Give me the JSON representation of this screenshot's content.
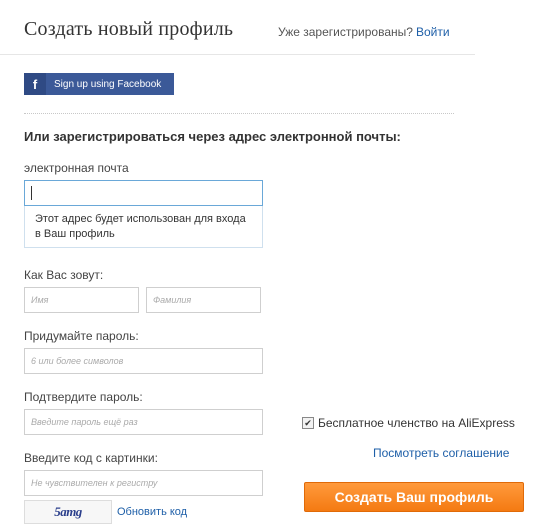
{
  "header": {
    "title": "Создать новый профиль",
    "already_text": "Уже зарегистрированы?",
    "login_link": "Войти"
  },
  "facebook": {
    "icon": "f",
    "label": "Sign up using Facebook",
    "color": "#3b5998"
  },
  "form": {
    "subheading": "Или зарегистрироваться через адрес электронной почты:",
    "email_label": "электронная почта",
    "email_value": "",
    "email_hint": "Этот адрес будет использован для входа в Ваш профиль",
    "name_label": "Как Вас зовут:",
    "first_name_placeholder": "Имя",
    "last_name_placeholder": "Фамилия",
    "password_label": "Придумайте пароль:",
    "password_placeholder": "6 или более символов",
    "confirm_label": "Подтвердите пароль:",
    "confirm_placeholder": "Введите пароль ещё раз",
    "captcha_label": "Введите код с картинки:",
    "captcha_placeholder": "Не чувствителен к регистру",
    "captcha_image_text": "5amg",
    "refresh_link": "Обновить код"
  },
  "side": {
    "membership_checkbox_label": "Бесплатное членство на AliExpress",
    "membership_checked": true,
    "agreement_link": "Посмотреть соглашение",
    "create_button": "Создать Ваш профиль",
    "accent_color": "#f47a12"
  }
}
